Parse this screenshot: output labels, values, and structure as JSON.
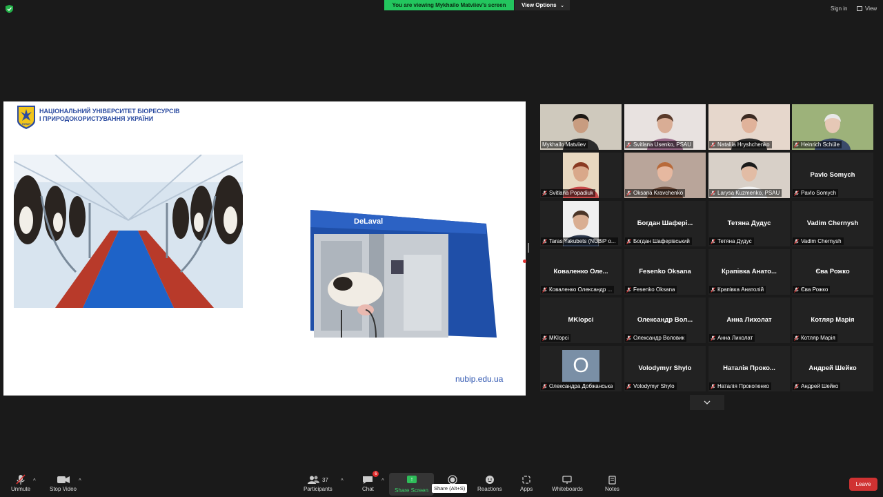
{
  "banner": {
    "viewing_text": "You are viewing Mykhailo Matviiev's screen",
    "view_options_label": "View Options"
  },
  "top_right": {
    "sign_in": "Sign in",
    "view": "View"
  },
  "slide": {
    "university_line1": "НАЦІОНАЛЬНИЙ УНІВЕРСИТЕТ БІОРЕСУРСІВ",
    "university_line2": "І ПРИРОДОКОРИСТУВАННЯ УКРАЇНИ",
    "logo_text": "НУБіП",
    "brand_robot": "DeLaval",
    "url": "nubip.edu.ua"
  },
  "gallery": {
    "tiles": [
      {
        "label": "Mykhailo Matviiev",
        "kind": "video",
        "active": true,
        "muted": false
      },
      {
        "label": "Svitlana Usenko, PSAU",
        "kind": "video",
        "muted": true
      },
      {
        "label": "Nataliia Hryshchenko",
        "kind": "video",
        "muted": true
      },
      {
        "label": "Heinrich Schüle",
        "kind": "video",
        "muted": true
      },
      {
        "label": "Svitlana Popadiuk",
        "kind": "video",
        "muted": true
      },
      {
        "label": "Oksana Kravchenko",
        "kind": "video",
        "muted": true
      },
      {
        "label": "Larysa Kuzmenko, PSAU",
        "kind": "video",
        "muted": true
      },
      {
        "label": "Pavlo Somych",
        "big": "Pavlo Somych",
        "kind": "name",
        "muted": true
      },
      {
        "label": "Taras Yakubets (NUBiP o...",
        "kind": "video",
        "muted": true
      },
      {
        "label": "Богдан Шаферівський",
        "big": "Богдан Шафері...",
        "kind": "name",
        "muted": true
      },
      {
        "label": "Тетяна Дудус",
        "big": "Тетяна Дудус",
        "kind": "name",
        "muted": true
      },
      {
        "label": "Vadim Chernysh",
        "big": "Vadim Chernysh",
        "kind": "name",
        "muted": true
      },
      {
        "label": "Коваленко Олександр ...",
        "big": "Коваленко Оле...",
        "kind": "name",
        "muted": true
      },
      {
        "label": "Fesenko Oksana",
        "big": "Fesenko Oksana",
        "kind": "name",
        "muted": true
      },
      {
        "label": "Крапівка Анатолій",
        "big": "Крапівка Анато...",
        "kind": "name",
        "muted": true
      },
      {
        "label": "Єва Рожко",
        "big": "Єва Рожко",
        "kind": "name",
        "muted": true
      },
      {
        "label": "MKlopci",
        "big": "MKlopci",
        "kind": "name",
        "muted": true
      },
      {
        "label": "Олександр Воловик",
        "big": "Олександр Вол...",
        "kind": "name",
        "muted": true
      },
      {
        "label": "Анна Лихолат",
        "big": "Анна Лихолат",
        "kind": "name",
        "muted": true
      },
      {
        "label": "Котляр Марія",
        "big": "Котляр Марія",
        "kind": "name",
        "muted": true
      },
      {
        "label": "Олександра Добжанська",
        "avatar": "O",
        "kind": "avatar",
        "muted": true
      },
      {
        "label": "Volodymyr Shylo",
        "big": "Volodymyr Shylo",
        "kind": "name",
        "muted": true
      },
      {
        "label": "Наталія Прокопенко",
        "big": "Наталія Проко...",
        "kind": "name",
        "muted": true
      },
      {
        "label": "Андрей Шейко",
        "big": "Андрей Шейко",
        "kind": "name",
        "muted": true
      }
    ]
  },
  "toolbar": {
    "unmute": "Unmute",
    "stop_video": "Stop Video",
    "participants": "Participants",
    "participants_count": "37",
    "chat": "Chat",
    "chat_badge": "6",
    "share_screen": "Share Screen",
    "share_tooltip": "Share (Alt+S)",
    "reactions": "Reactions",
    "apps": "Apps",
    "whiteboards": "Whiteboards",
    "notes": "Notes",
    "leave": "Leave"
  },
  "colors": {
    "banner_green": "#23c55e",
    "active_tile_outline": "#c6e04c",
    "leave_red": "#d03232",
    "share_green": "#2ebd59",
    "university_blue": "#2a4aa0"
  }
}
